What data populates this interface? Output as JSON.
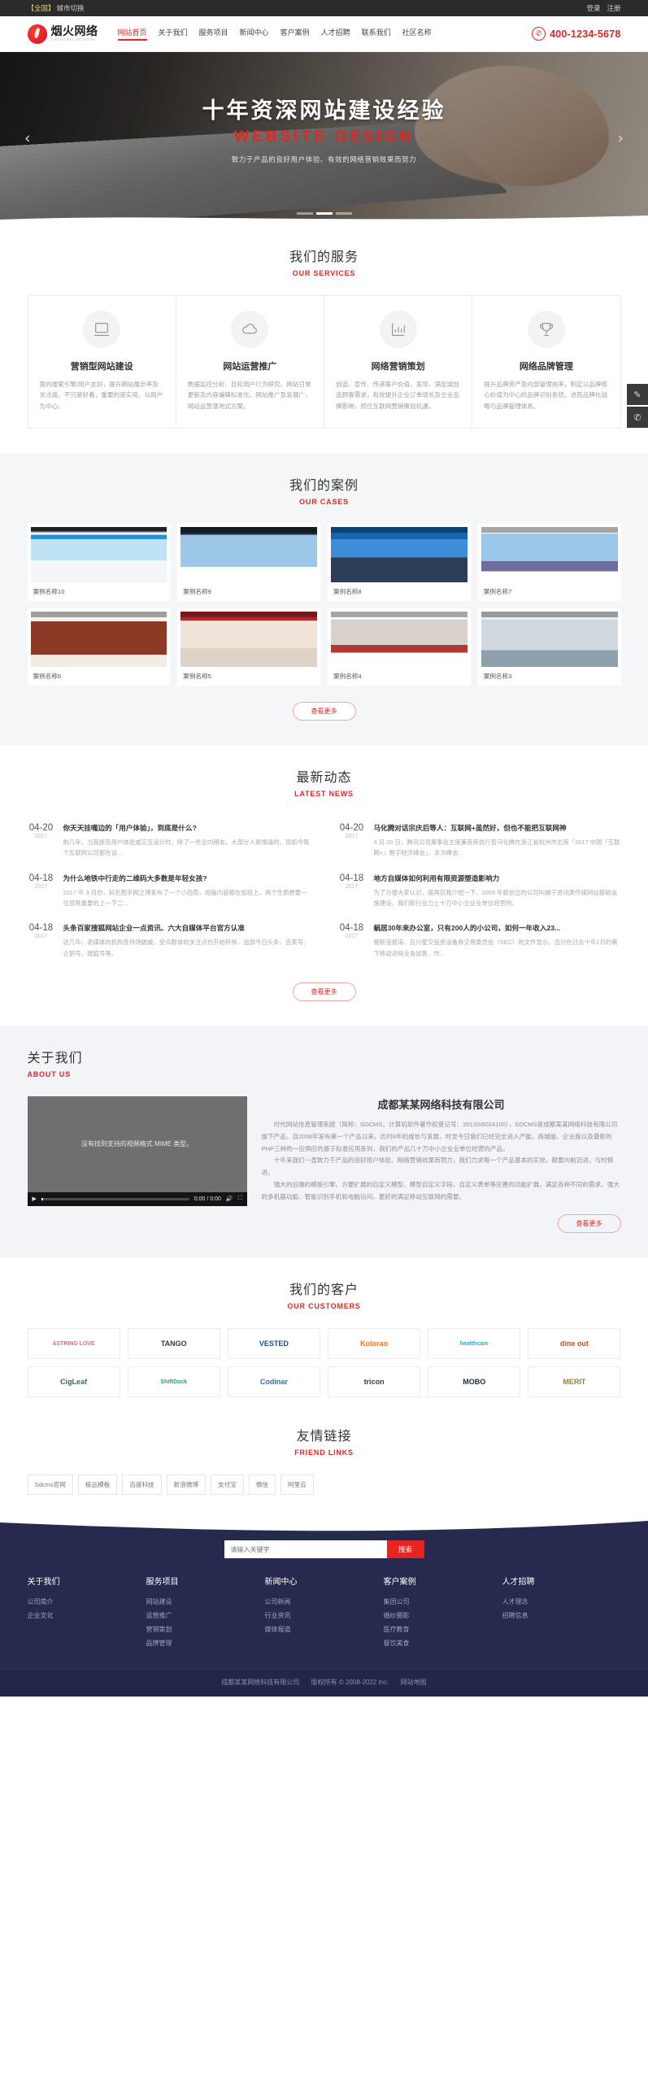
{
  "topbar": {
    "region": "【全国】",
    "city_switch": "城市切换",
    "login": "登录",
    "register": "注册"
  },
  "header": {
    "logo_cn": "烟火网络",
    "logo_en": "FIREWORKS NETWORK",
    "phone": "400-1234-5678",
    "phone_icon": "phone-icon",
    "nav": [
      {
        "label": "网站首页",
        "active": true
      },
      {
        "label": "关于我们",
        "active": false
      },
      {
        "label": "服务项目",
        "active": false
      },
      {
        "label": "新闻中心",
        "active": false
      },
      {
        "label": "客户案例",
        "active": false
      },
      {
        "label": "人才招聘",
        "active": false
      },
      {
        "label": "联系我们",
        "active": false
      },
      {
        "label": "社区名称",
        "active": false
      }
    ]
  },
  "banner": {
    "title": "十年资深网站建设经验",
    "subtitle": "WEBSITE DESIGN",
    "desc": "致力于产品的良好用户体验、有效的网络营销效果而努力",
    "prev_icon": "chevron-left-icon",
    "next_icon": "chevron-right-icon",
    "slides": 3,
    "active_slide": 1
  },
  "side_tools": [
    {
      "name": "feedback-icon",
      "glyph": "✎"
    },
    {
      "name": "phone-icon",
      "glyph": "✆"
    }
  ],
  "services": {
    "title_cn": "我们的服务",
    "title_en": "OUR SERVICES",
    "items": [
      {
        "icon": "laptop-icon",
        "title": "营销型网站建设",
        "desc": "面向搜索引擎/用户友好，提升网站展示率及关注度。不只是好看，重要的是实用，以用户为中心。"
      },
      {
        "icon": "cloud-icon",
        "title": "网站运营推广",
        "desc": "数据监控分析、目标用户行为研究、网站日常更新及内容编辑标准化，网站推广及发展广，网站运营落地式方案。"
      },
      {
        "icon": "chart-icon",
        "title": "网络营销策划",
        "desc": "创造、宣传、传递客户价值，发现、满足或创造顾客需求，有效提升企业订单增长及企业品牌影响，抓住互联网营销策划机遇。"
      },
      {
        "icon": "trophy-icon",
        "title": "网络品牌管理",
        "desc": "提升品牌资产及内部管理效率，制定以品牌核心价值为中心的品牌识别系统，进而品牌化战略与品牌管理体系。"
      }
    ]
  },
  "cases": {
    "title_cn": "我们的案例",
    "title_en": "OUR CASES",
    "more": "查看更多",
    "items": [
      {
        "label": "案例名称10",
        "theme": "t1"
      },
      {
        "label": "案例名称9",
        "theme": "t2"
      },
      {
        "label": "案例名称8",
        "theme": "t3"
      },
      {
        "label": "案例名称7",
        "theme": "t4"
      },
      {
        "label": "案例名称6",
        "theme": "t5"
      },
      {
        "label": "案例名称5",
        "theme": "t6"
      },
      {
        "label": "案例名称4",
        "theme": "t7"
      },
      {
        "label": "案例名称3",
        "theme": "t8"
      }
    ]
  },
  "news": {
    "title_cn": "最新动态",
    "title_en": "LATEST NEWS",
    "more": "查看更多",
    "items": [
      {
        "day": "04-20",
        "year": "2017",
        "title": "你天天挂嘴边的「用户体验」，到底是什么?",
        "excerpt": "前几年，当我提及用户体验或交互设计时，除了一些业内朋友，大部分人是懵逼的。现如今每个互联网公司都在谈..."
      },
      {
        "day": "04-20",
        "year": "2017",
        "title": "马化腾对话宗庆后等人：互联网+虽然好，但也不能把互联网神",
        "excerpt": "4 月 20 日，腾讯公司董事会主席兼首席执行官马化腾在浙江省杭州市出席「2017 中国『互联网+』数字经济峰会」，本次峰会..."
      },
      {
        "day": "04-18",
        "year": "2017",
        "title": "为什么地铁中行走的二维码大多数是年轻女孩?",
        "excerpt": "2017 年 3 月份，知名图手网之博发布了一个小趋势，组版内容都在加班上，两个生质想要一位贸易重要的上一下二..."
      },
      {
        "day": "04-18",
        "year": "2017",
        "title": "地方自媒体如何利用有限资源塑造影响力",
        "excerpt": "为了方便大家认识，我再自我介绍一下，2009 年就创立的公司叫做于资讯类传媒网站基础设施建设，我们新行业力上十万中小企业业单位经营的。"
      },
      {
        "day": "04-18",
        "year": "2017",
        "title": "头条百家搜狐网站企业一点资讯、六大自媒体平台官方认准",
        "excerpt": "这几年，老媒体的机构各持场破威，受众群体的关注点也开始转移，追加今日头条、百家号、企鹅号、搜狐号等。"
      },
      {
        "day": "04-18",
        "year": "2017",
        "title": "蜗居30年来办公室，只有200人的小公司，如何一年收入23...",
        "excerpt": "据新浪报道，百兴星交投资设备券交易委员会（SEC）的文件显示，百兴在过去十年1月的第下移动进程业务加售，作..."
      }
    ]
  },
  "about": {
    "title_cn": "关于我们",
    "title_en": "ABOUT US",
    "company": "成都某某网络科技有限公司",
    "video_placeholder": "没有找到支持的视频格式 MIME 类型。",
    "video_time": "0:00 / 0:00",
    "more": "查看更多",
    "paragraphs": [
      "时代网站信息管理系统（简称：SDCMS，计算机软件著作权登记号：2013SR024100），SDCMS是成都某某网络科技有限公司旗下产品，自2008年发布第一个产品以来，历时8年的成长与发展，时至今日我们已经完全进入产能、商城版、企业版以及最新的PHP三种的一应俱应的基于标准应用系列，我们的产品几十万中小企业业单位经营的产品。",
      "十年来我们一直致力于产品的良好用户体验、网络营销效果而努力，我们力求每一个产品基本的实效，都要向前迈进，与时俱进。",
      "强大的后端的模板引擎、方便扩展的自定义模型、模型自定义字段、自定义表单等完善的功能扩展，满足各种不同的需求。强大的多机器功能、智能识别手机和电脑访问，更好的满足移动互联网的需要。"
    ]
  },
  "customers": {
    "title_cn": "我们的客户",
    "title_en": "OUR CUSTOMERS",
    "logos": [
      "ASTRING LOVE",
      "TANGO",
      "VESTED",
      "Kolorao",
      "healthcare",
      "dine out",
      "CigLeaf",
      "ShiftDock",
      "Codinar",
      "tricon",
      "MOBO",
      "MERIT"
    ]
  },
  "friend_links": {
    "title_cn": "友情链接",
    "title_en": "FRIEND LINKS",
    "links": [
      "Sdcms官网",
      "极品模板",
      "百度科技",
      "新浪微博",
      "支付宝",
      "微信",
      "阿里云"
    ]
  },
  "footer": {
    "search_placeholder": "请输入关键字",
    "search_button": "搜索",
    "columns": [
      {
        "title": "关于我们",
        "links": [
          "公司简介",
          "企业文化"
        ]
      },
      {
        "title": "服务项目",
        "links": [
          "网站建设",
          "运营推广",
          "营销策划",
          "品牌管理"
        ]
      },
      {
        "title": "新闻中心",
        "links": [
          "公司新闻",
          "行业资讯",
          "媒体报道"
        ]
      },
      {
        "title": "客户案例",
        "links": [
          "集团公司",
          "婚纱摄影",
          "医疗教育",
          "餐饮美食"
        ]
      },
      {
        "title": "人才招聘",
        "links": [
          "人才理念",
          "招聘信息"
        ]
      }
    ],
    "copyright_company": "成都某某网络科技有限公司",
    "copyright_text": "版权所有 © 2008-2022 Inc.",
    "sitemap": "网站地图"
  },
  "colors": {
    "accent": "#e8241f",
    "footer_bg": "#262a4f",
    "topbar_bg": "#2b2b2b"
  }
}
